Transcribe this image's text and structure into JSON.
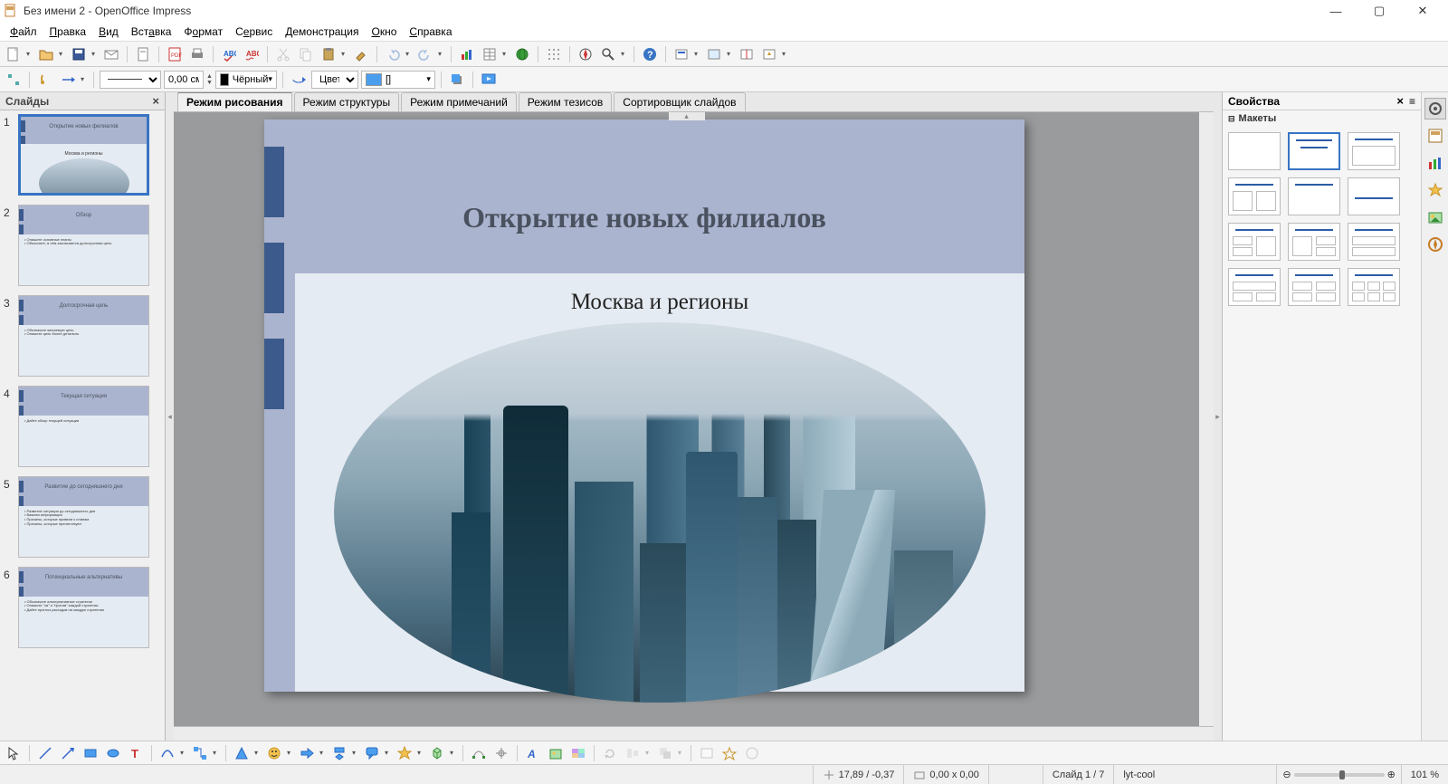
{
  "window": {
    "title": "Без имени 2 - OpenOffice Impress"
  },
  "menus": [
    "Файл",
    "Правка",
    "Вид",
    "Вставка",
    "Формат",
    "Сервис",
    "Демонстрация",
    "Окно",
    "Справка"
  ],
  "toolbar2": {
    "line_width": "0,00 см",
    "line_color_label": "Чёрный",
    "fill_type": "Цвет",
    "fill_pattern": "[]"
  },
  "slides_panel": {
    "title": "Слайды"
  },
  "thumbnails": [
    {
      "num": "1",
      "title": "Открытие новых филиалов",
      "subtitle": "Москва и регионы",
      "type": "title",
      "selected": true
    },
    {
      "num": "2",
      "title": "Обзор",
      "body": [
        "Опишите основные планы",
        "Объясните, в чём заключается долгосрочная цель"
      ],
      "type": "content"
    },
    {
      "num": "3",
      "title": "Долгосрочная цель",
      "body": [
        "Обозначьте желаемую цель",
        "Опишите цель более детально"
      ],
      "type": "content"
    },
    {
      "num": "4",
      "title": "Текущая ситуация",
      "body": [
        "Дайте обзор текущей ситуации"
      ],
      "type": "content"
    },
    {
      "num": "5",
      "title": "Развитие до сегодняшнего дня",
      "body": [
        "Развитие ситуации до сегодняшнего дня",
        "Важная информация",
        "Причины, которые привели к планам",
        "Причины, которые препятствуют"
      ],
      "type": "content"
    },
    {
      "num": "6",
      "title": "Потенциальные альтернативы",
      "body": [
        "Обозначьте альтернативные стратегии",
        "Опишите \"за\" и \"против\" каждой стратегии",
        "Дайте прогноз расходов на каждую стратегию"
      ],
      "type": "content"
    }
  ],
  "view_modes": {
    "drawing": "Режим рисования",
    "outline": "Режим структуры",
    "notes": "Режим примечаний",
    "handout": "Режим тезисов",
    "sorter": "Сортировщик слайдов"
  },
  "current_slide": {
    "title": "Открытие новых филиалов",
    "subtitle": "Москва и регионы"
  },
  "properties_panel": {
    "title": "Свойства",
    "section_layouts": "Макеты"
  },
  "statusbar": {
    "cursor_pos": "17,89 / -0,37",
    "selection_size": "0,00 x 0,00",
    "slide_info": "Слайд 1 / 7",
    "template": "lyt-cool",
    "zoom": "101 %"
  }
}
